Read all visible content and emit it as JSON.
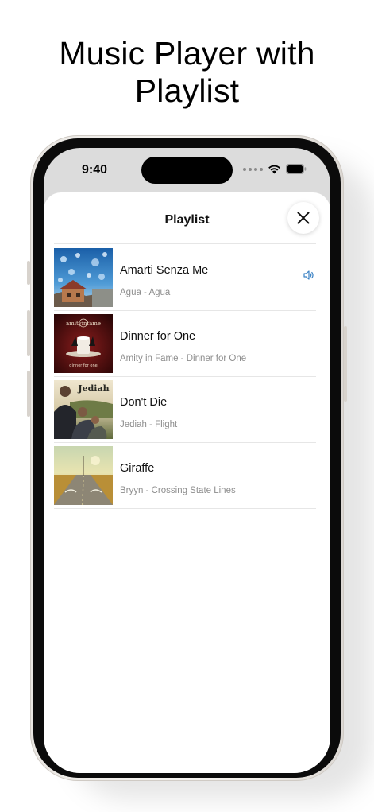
{
  "headline": {
    "line1": "Music Player with",
    "line2": "Playlist"
  },
  "status_bar": {
    "time": "9:40",
    "icons": [
      "cellular-dots-icon",
      "wifi-icon",
      "battery-icon"
    ]
  },
  "sheet": {
    "title": "Playlist",
    "close_icon": "close-icon"
  },
  "playlist": [
    {
      "title": "Amarti Senza Me",
      "subtitle": "Agua - Agua",
      "playing": true
    },
    {
      "title": "Dinner for One",
      "subtitle": "Amity in Fame - Dinner for One",
      "playing": false,
      "cover_text": "amityinfame",
      "cover_caption": "dinner for one"
    },
    {
      "title": "Don't Die",
      "subtitle": "Jediah - Flight",
      "playing": false,
      "cover_text": "Jediah"
    },
    {
      "title": "Giraffe",
      "subtitle": "Bryyn - Crossing State Lines",
      "playing": false
    }
  ],
  "colors": {
    "accent": "#3b82c4",
    "subtitle": "#8e8e8e",
    "divider": "#e6e6e6"
  }
}
